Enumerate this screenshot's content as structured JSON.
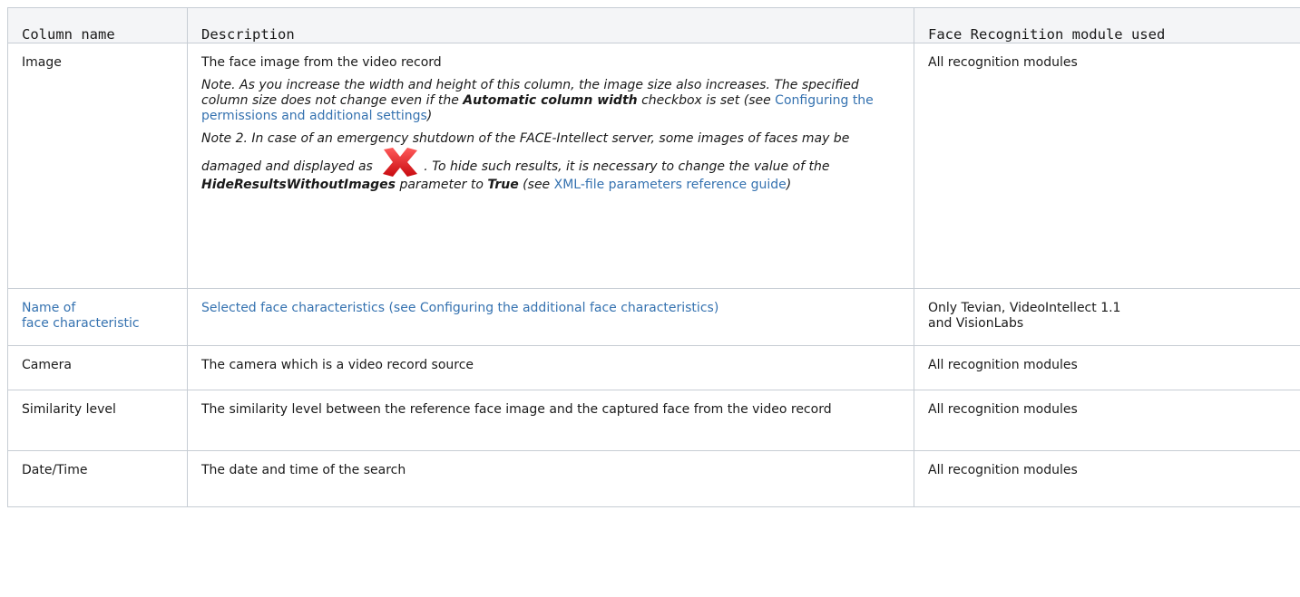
{
  "headers": [
    "Column name",
    "Description",
    "Face Recognition module used"
  ],
  "rows": [
    {
      "name": "Image",
      "description": "The face image from the video record",
      "note1": {
        "before": "Note. As you increase the width and height of this column, the image size also increases. The specified column size does not change even if the ",
        "bold": "Automatic column width",
        "middle": " checkbox is set (see ",
        "link": "Configuring the permissions and additional settings",
        "after": ")"
      },
      "note2": {
        "before": "Note 2. In case of an emergency shutdown of the FACE-Intellect server, some images of faces may be damaged and displayed as ",
        "middle": ". To hide such results, it is necessary to change the value of the ",
        "bold1": "HideResultsWithoutImages",
        "middle2": " parameter to ",
        "bold2": "True",
        "middle3": " (see ",
        "link": "XML-file parameters reference guide",
        "after": ")"
      },
      "modules": "All recognition modules"
    },
    {
      "name_line1": "Name of",
      "name_line2": "face characteristic",
      "description": "Selected face characteristics (see ",
      "link": "Configuring the additional face characteristics",
      "after": ")",
      "modules_line1": "Only Tevian, VideoIntellect 1.1",
      "modules_line2": "and VisionLabs"
    },
    {
      "name": "Camera",
      "description": "The camera which is a video record source",
      "modules": "All recognition modules"
    },
    {
      "name": "Similarity level",
      "description": "The similarity level between the reference face image and the captured face from the video record",
      "modules": "All recognition modules"
    },
    {
      "name": "Date/Time",
      "description": "The date and time of the search",
      "modules": "All recognition modules"
    }
  ],
  "colors": {
    "link": "#3572b0",
    "header_bg": "#f4f5f7",
    "border": "#c7cdd4",
    "error_icon": "#e8161b"
  }
}
